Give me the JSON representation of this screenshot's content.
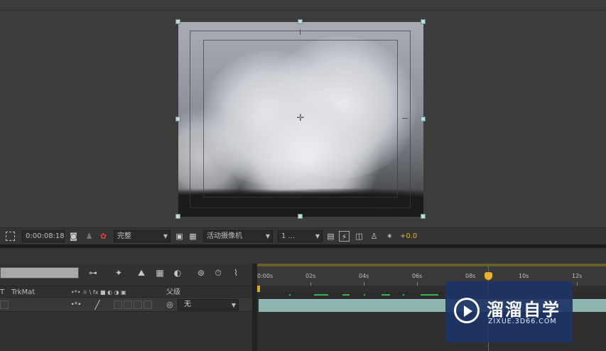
{
  "viewer": {
    "toolbar": {
      "timecode": "0:00:08:18",
      "resolution": "完整",
      "camera": "活动摄像机",
      "views": "1 ...",
      "exposure": "+0.0"
    }
  },
  "timeline": {
    "column_headers": {
      "trkmat_prefix": "T",
      "trkmat": "TrkMat",
      "switches": "•*• ☼ \\ fx ■ ◐ ◑ ▣",
      "parent": "父级"
    },
    "layer": {
      "parent_value": "无"
    },
    "ruler_labels": [
      "0:00s",
      "02s",
      "04s",
      "06s",
      "08s",
      "10s",
      "12s"
    ]
  },
  "watermark": {
    "title": "溜溜自学",
    "subtitle": "ZIXUE.3D66.COM"
  },
  "colors": {
    "handle": "#b9dcd8",
    "layer_bar": "#8fb5b1",
    "cti": "#e6b12c",
    "offset": "#e3b43a",
    "watermark_bg": "#1c3466"
  }
}
